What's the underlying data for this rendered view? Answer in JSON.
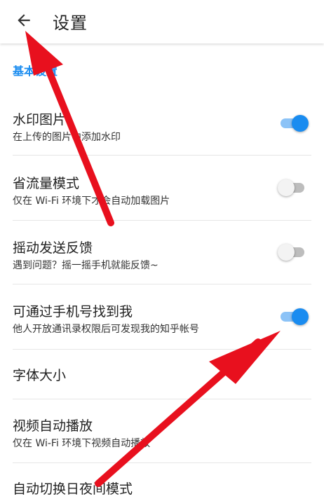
{
  "header": {
    "title": "设置",
    "back_icon": "arrow-left-icon"
  },
  "section": {
    "label": "基本设置"
  },
  "settings": [
    {
      "title": "水印图片",
      "subtitle": "在上传的图片中添加水印",
      "switch": "on"
    },
    {
      "title": "省流量模式",
      "subtitle": "仅在 Wi-Fi 环境下才会自动加载图片",
      "switch": "off"
    },
    {
      "title": "摇动发送反馈",
      "subtitle": "遇到问题？摇一摇手机就能反馈~",
      "switch": "off"
    },
    {
      "title": "可通过手机号找到我",
      "subtitle": "他人开放通讯录权限后可发现我的知乎帐号",
      "switch": "on"
    },
    {
      "title": "字体大小"
    },
    {
      "title": "视频自动播放",
      "subtitle": "仅在 Wi-Fi 环境下视频自动播放"
    },
    {
      "title": "自动切换日夜间模式"
    }
  ],
  "colors": {
    "accent": "#1a8cf0",
    "switch_on_track": "#8cc3f7",
    "switch_off_track": "#bdbdbd",
    "annotation_arrow": "#e8101e"
  }
}
